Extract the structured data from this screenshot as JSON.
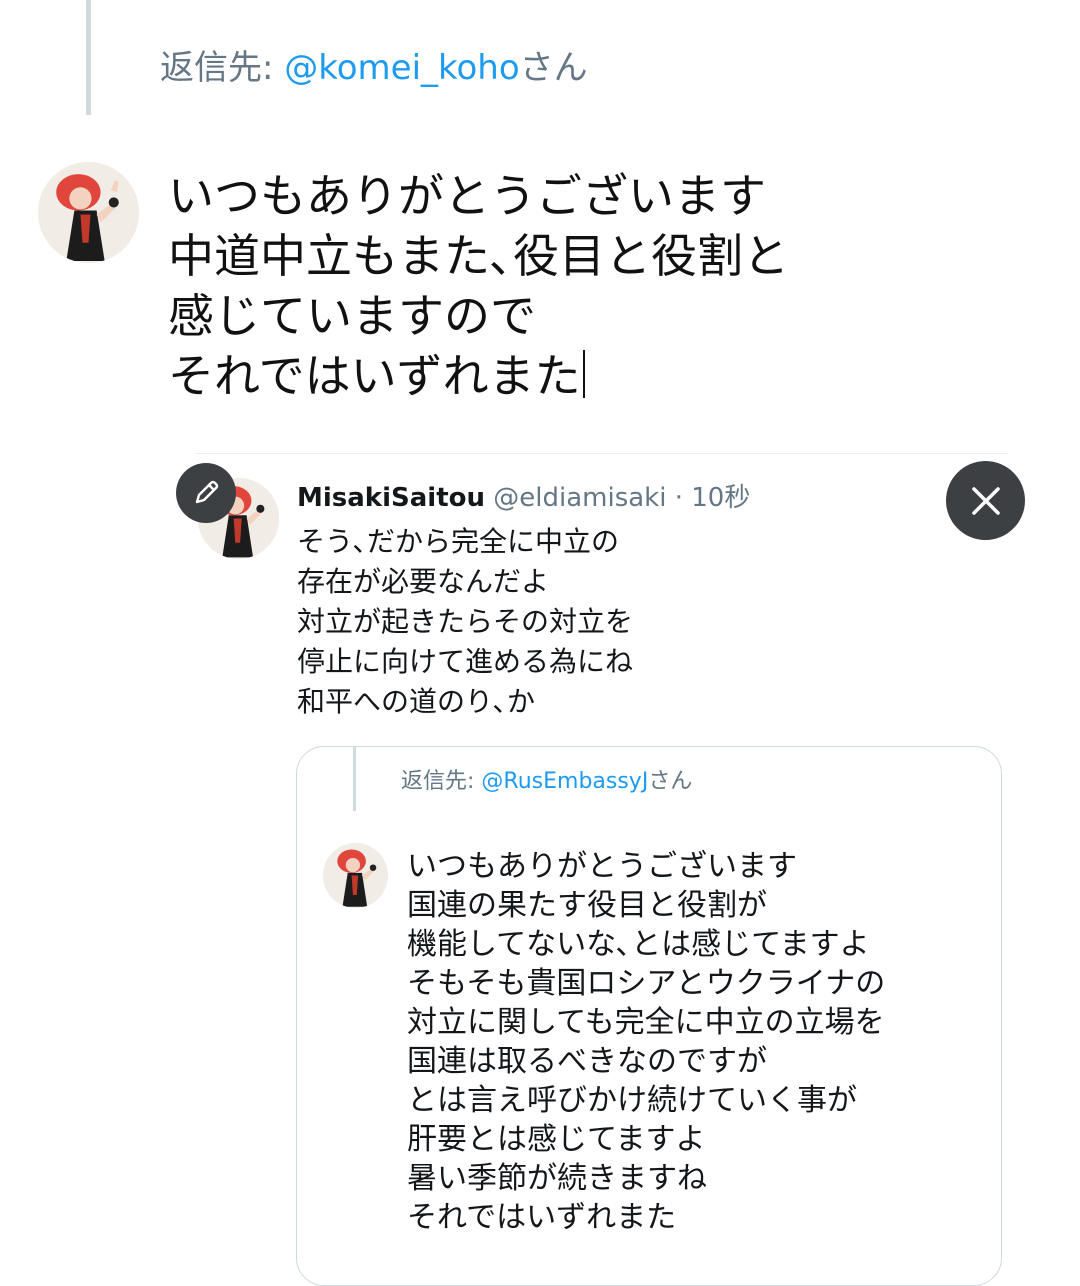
{
  "reply_header": {
    "prefix": "返信先: ",
    "handle": "@komei_koho",
    "suffix": "さん"
  },
  "compose": {
    "lines": [
      "いつもありがとうございます",
      "中道中立もまた､役目と役割と",
      "感じていますので",
      "それではいずれまた"
    ]
  },
  "quoted_tweet": {
    "name": "MisakiSaitou",
    "handle": "@eldiamisaki",
    "separator": "·",
    "time": "10秒",
    "lines": [
      "そう､だから完全に中立の",
      "存在が必要なんだよ",
      "対立が起きたらその対立を",
      "停止に向けて進める為にね",
      "和平への道のり､か"
    ]
  },
  "embedded_card": {
    "reply_prefix": "返信先: ",
    "reply_handle": "@RusEmbassyJ",
    "reply_suffix": "さん",
    "lines": [
      "いつもありがとうございます",
      "国連の果たす役目と役割が",
      "機能してないな､とは感じてますよ",
      "そもそも貴国ロシアとウクライナの",
      "対立に関しても完全に中立の立場を",
      "国連は取るべきなのですが",
      "とは言え呼びかけ続けていく事が",
      "肝要とは感じてますよ",
      "暑い季節が続きますね",
      "それではいずれまた"
    ]
  },
  "icons": {
    "edit": "pencil-icon",
    "close": "close-icon"
  },
  "colors": {
    "link": "#1d9bf0",
    "secondary_text": "#657786",
    "button_dark": "#3c4043"
  }
}
